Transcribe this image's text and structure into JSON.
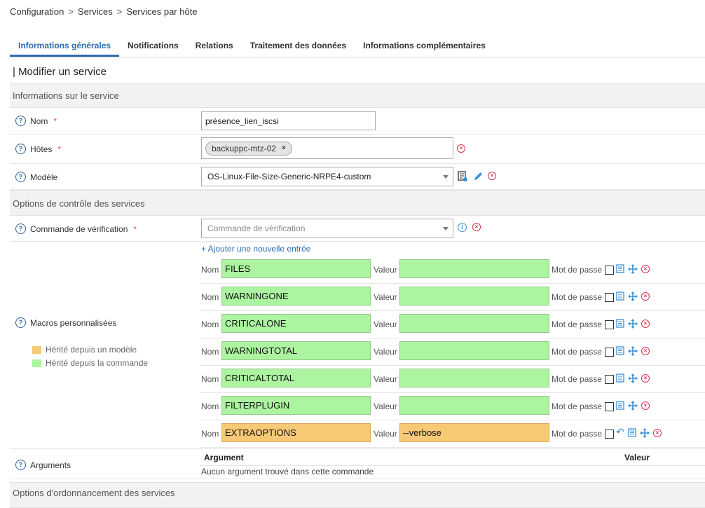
{
  "breadcrumb": [
    "Configuration",
    ">",
    "Services",
    ">",
    "Services par hôte"
  ],
  "tabs": [
    "Informations générales",
    "Notifications",
    "Relations",
    "Traitement des données",
    "Informations complémentaires"
  ],
  "page_title": "| Modifier un service",
  "sections": {
    "service_info": "Informations sur le service",
    "control_options": "Options de contrôle des services",
    "scheduling": "Options d'ordonnancement des services"
  },
  "fields": {
    "name": {
      "label": "Nom",
      "required": "*",
      "value": "présence_lien_iscsi"
    },
    "hosts": {
      "label": "Hôtes",
      "required": "*",
      "chip": "backuppc-mtz-02",
      "chip_remove": "×"
    },
    "template": {
      "label": "Modèle",
      "value": "OS-Linux-File-Size-Generic-NRPE4-custom"
    },
    "check_command": {
      "label": "Commande de vérification",
      "required": "*",
      "placeholder": "Commande de vérification"
    },
    "macros": {
      "label": "Macros personnalisées"
    },
    "arguments": {
      "label": "Arguments"
    }
  },
  "macros": {
    "add_label": "+ Ajouter une nouvelle entrée",
    "name_label": "Nom",
    "value_label": "Valeur",
    "password_label": "Mot de passe",
    "items": [
      {
        "name": "FILES",
        "value": "",
        "source": "command"
      },
      {
        "name": "WARNINGONE",
        "value": "",
        "source": "command"
      },
      {
        "name": "CRITICALONE",
        "value": "",
        "source": "command"
      },
      {
        "name": "WARNINGTOTAL",
        "value": "",
        "source": "command"
      },
      {
        "name": "CRITICALTOTAL",
        "value": "",
        "source": "command"
      },
      {
        "name": "FILTERPLUGIN",
        "value": "",
        "source": "command"
      },
      {
        "name": "EXTRAOPTIONS",
        "value": "--verbose",
        "source": "template"
      }
    ]
  },
  "legend": {
    "template": "Hérité depuis un modèle",
    "command": "Hérité depuis la commande"
  },
  "arguments": {
    "col_argument": "Argument",
    "col_value": "Valeur",
    "empty": "Aucun argument trouvé dans cette commande"
  },
  "colors": {
    "accent": "#2b6cb0",
    "template": "#f8c974",
    "command": "#acf4a0",
    "danger": "#d9304f"
  }
}
